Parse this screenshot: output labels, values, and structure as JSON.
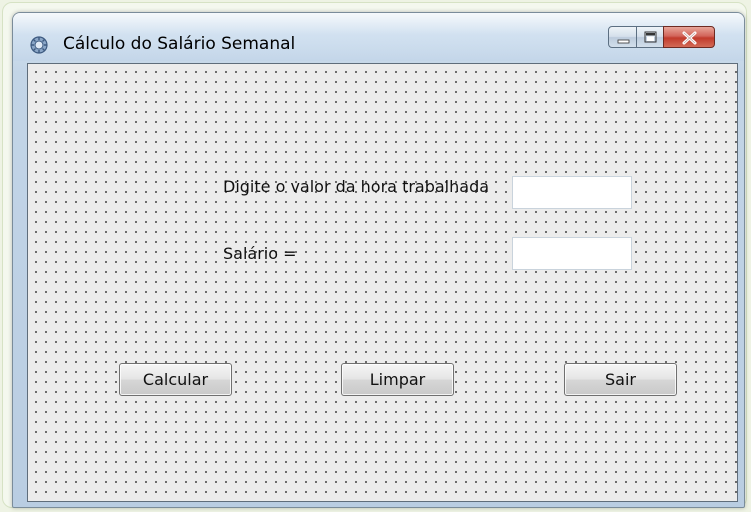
{
  "window": {
    "title": "Cálculo do Salário Semanal",
    "icon": "java-duke-icon"
  },
  "caption_buttons": {
    "minimize_icon": "minimize-icon",
    "maximize_icon": "maximize-icon",
    "close_icon": "close-icon"
  },
  "form": {
    "hour_label": "Digite o valor da hora trabalhada",
    "hour_value": "",
    "salary_label": "Salário =",
    "salary_value": ""
  },
  "buttons": {
    "calcular": "Calcular",
    "limpar": "Limpar",
    "sair": "Sair"
  },
  "colors": {
    "close_button": "#c13b2c",
    "titlebar": "#c3d5e7",
    "client_background": "#ececec"
  }
}
